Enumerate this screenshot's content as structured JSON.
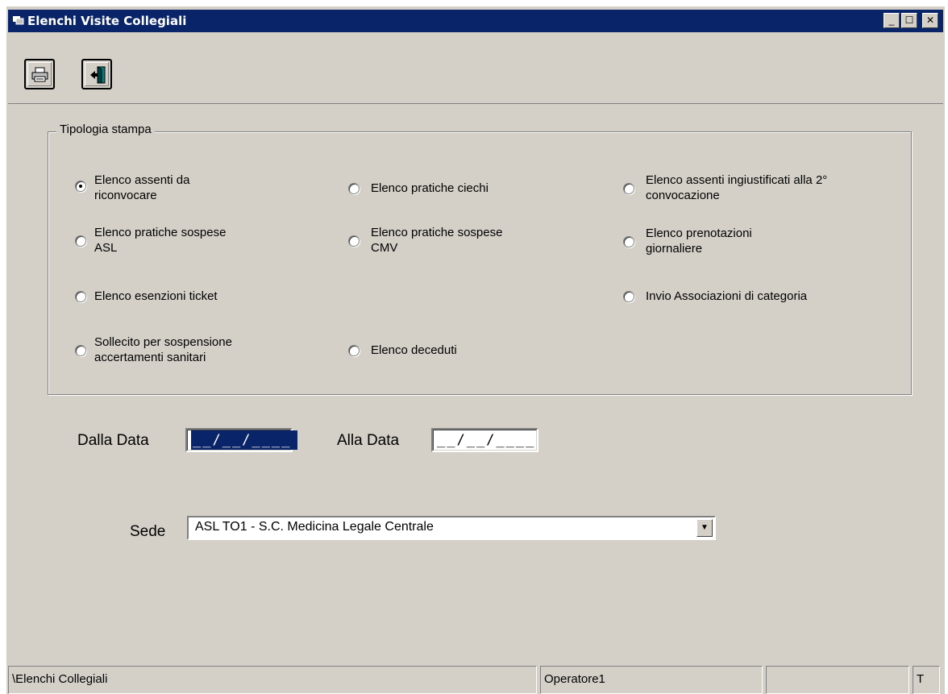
{
  "window": {
    "title": "Elenchi Visite Collegiali",
    "minimize": "_",
    "maximize": "☐",
    "close": "✕"
  },
  "toolbar": {
    "print_icon": "printer-icon",
    "exit_icon": "exit-door-icon"
  },
  "group": {
    "label": "Tipologia stampa",
    "options": [
      {
        "line1": "Elenco assenti da",
        "line2": "riconvocare",
        "checked": true
      },
      {
        "line1": "Elenco pratiche ciechi",
        "line2": "",
        "checked": false
      },
      {
        "line1": "Elenco assenti ingiustificati alla 2°",
        "line2": "convocazione",
        "checked": false
      },
      {
        "line1": "Elenco pratiche sospese",
        "line2": "ASL",
        "checked": false
      },
      {
        "line1": "Elenco pratiche sospese",
        "line2": "CMV",
        "checked": false
      },
      {
        "line1": "Elenco prenotazioni",
        "line2": "giornaliere",
        "checked": false
      },
      {
        "line1": "Elenco esenzioni ticket",
        "line2": "",
        "checked": false
      },
      {
        "line1": "Invio Associazioni di categoria",
        "line2": "",
        "checked": false
      },
      {
        "line1": "Sollecito per sospensione",
        "line2": "accertamenti sanitari",
        "checked": false
      },
      {
        "line1": "Elenco deceduti",
        "line2": "",
        "checked": false
      }
    ]
  },
  "dates": {
    "from_label": "Dalla Data",
    "from_value": "__/__/____",
    "to_label": "Alla Data",
    "to_value": "__/__/____"
  },
  "sede": {
    "label": "Sede",
    "value": "ASL TO1 - S.C. Medicina Legale Centrale"
  },
  "status": {
    "path": "\\Elenchi Collegiali",
    "operator": "Operatore1",
    "empty": "",
    "flag": "T"
  },
  "colors": {
    "titlebar": "#0a246a",
    "face": "#d4d0c8",
    "selection": "#0a246a"
  }
}
